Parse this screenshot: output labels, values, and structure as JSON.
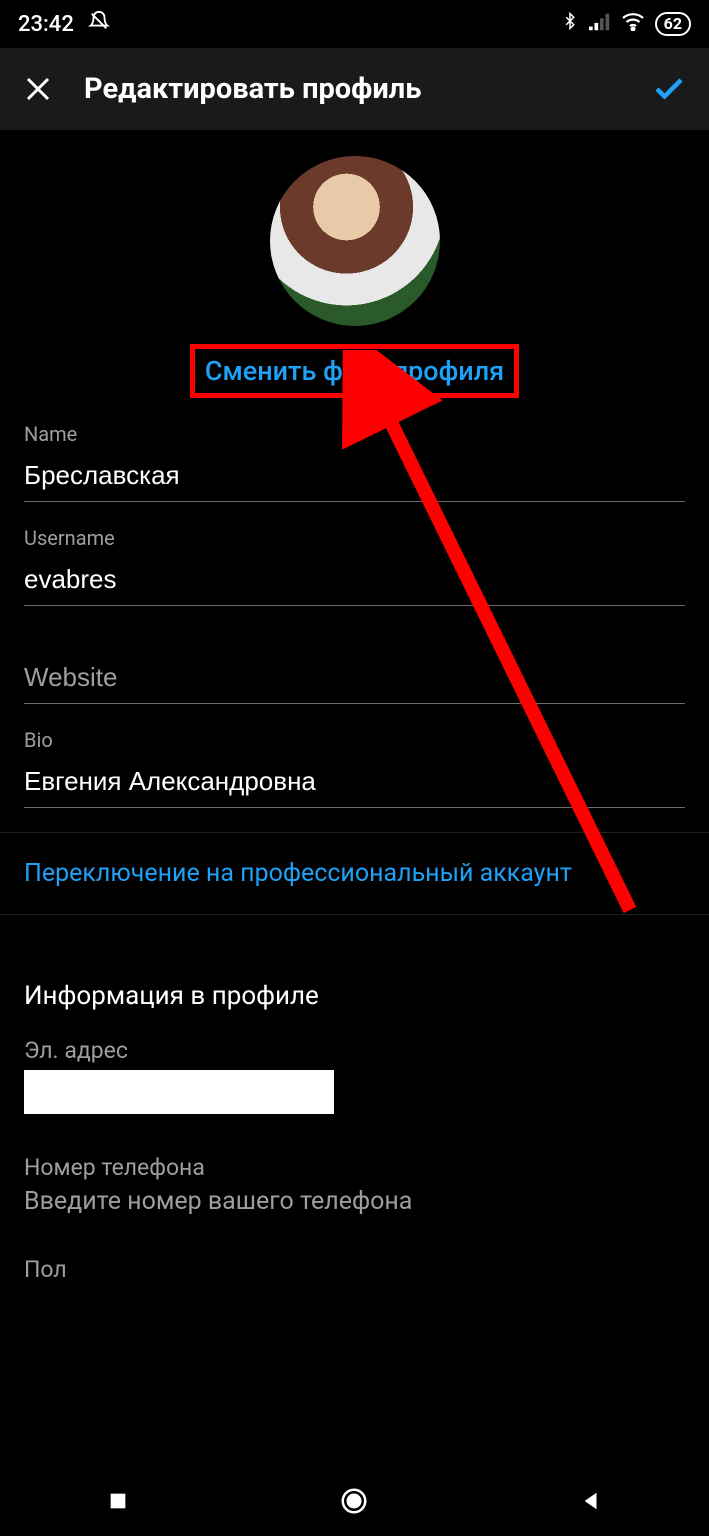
{
  "status": {
    "time": "23:42",
    "battery": "62"
  },
  "header": {
    "title": "Редактировать профиль"
  },
  "profile": {
    "change_photo_label": "Сменить фото профиля"
  },
  "fields": {
    "name_label": "Name",
    "name_value": "Бреславская",
    "username_label": "Username",
    "username_value": "evabres",
    "website_label": "Website",
    "website_value": "",
    "bio_label": "Bio",
    "bio_value": "Евгения Александровна"
  },
  "links": {
    "switch_professional": "Переключение на профессиональный аккаунт"
  },
  "info_section": {
    "title": "Информация в профиле",
    "email_label": "Эл. адрес",
    "phone_label": "Номер телефона",
    "phone_placeholder": "Введите номер вашего телефона",
    "gender_label": "Пол"
  }
}
